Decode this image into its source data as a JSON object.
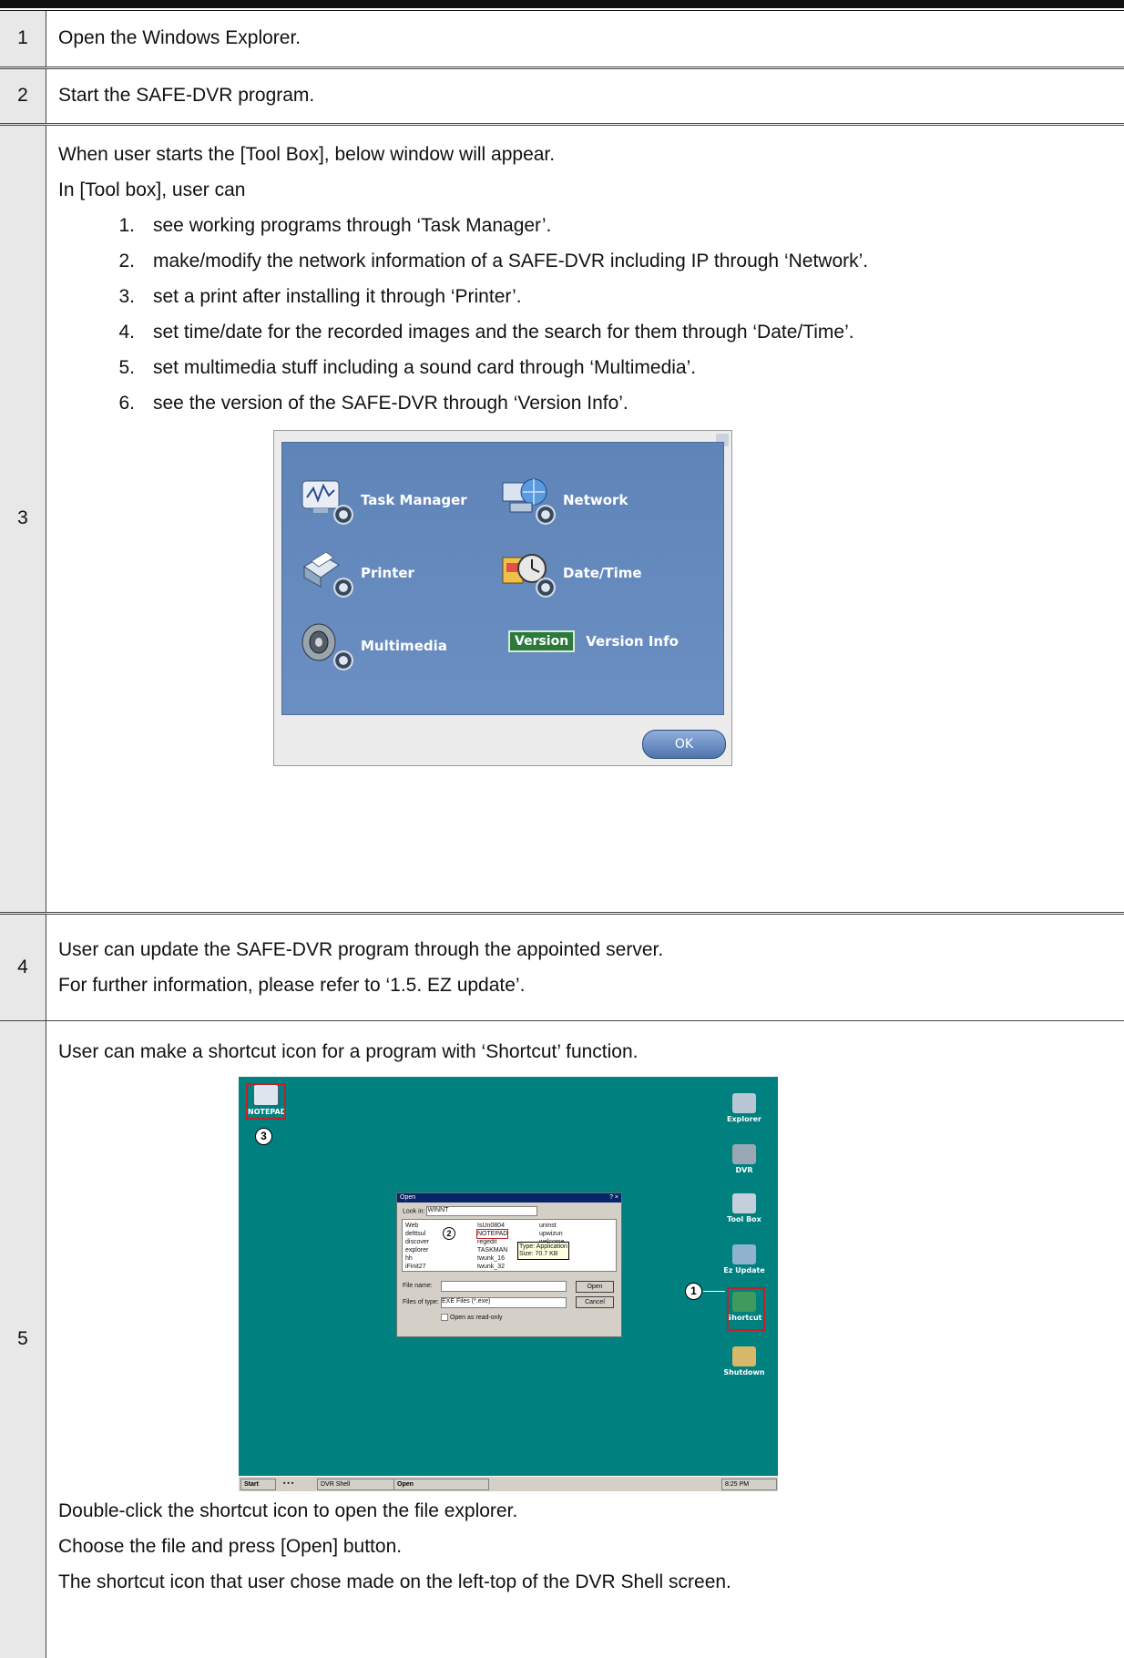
{
  "rows": [
    {
      "num": "1",
      "text": "Open the Windows Explorer."
    },
    {
      "num": "2",
      "text": "Start the SAFE-DVR program."
    },
    {
      "num": "3",
      "intro": "When user starts the [Tool Box], below window will appear.",
      "lead": "In [Tool box], user can",
      "items": [
        {
          "n": "1.",
          "text": "see working programs through ‘Task Manager’."
        },
        {
          "n": "2.",
          "text": "make/modify the network information of a SAFE-DVR including IP through ‘Network’."
        },
        {
          "n": "3.",
          "text": "set a print after installing it through ‘Printer’."
        },
        {
          "n": "4.",
          "text": "set time/date for the recorded images and the search for them through ‘Date/Time’."
        },
        {
          "n": "5.",
          "text": "set multimedia stuff including a sound card through ‘Multimedia’."
        },
        {
          "n": "6.",
          "text": "see the version of the SAFE-DVR through ‘Version Info’."
        }
      ],
      "toolbox": {
        "task_manager": "Task Manager",
        "network": "Network",
        "printer": "Printer",
        "date_time": "Date/Time",
        "multimedia": "Multimedia",
        "version_badge": "Version",
        "version_info": "Version Info",
        "ok": "OK"
      }
    },
    {
      "num": "4",
      "line1": "User can update the SAFE-DVR program through the appointed server.",
      "line2": "For further information, please refer to ‘1.5. EZ update’."
    },
    {
      "num": "5",
      "intro": "User can make a shortcut icon for a program with ‘Shortcut’ function.",
      "after": [
        "Double-click the shortcut icon to open the file explorer.",
        "Choose the file and press [Open] button.",
        "The shortcut icon that user chose made on the left-top of the DVR Shell screen."
      ],
      "desktop": {
        "notepad_icon": "NOTEPAD",
        "callout_1": "1",
        "callout_2": "2",
        "callout_3": "3",
        "side_icons": [
          "Explorer",
          "DVR",
          "Tool Box",
          "Ez Update",
          "Shortcut",
          "Shutdown"
        ],
        "dialog": {
          "title": "Open",
          "help_close": "? ×",
          "look_in_label": "Look in:",
          "look_in_value": "WINNT",
          "files_col1": [
            "Web",
            "delttsul",
            "discover",
            "explorer",
            "hh",
            "iFinit27"
          ],
          "files_col2": [
            "IsUn0804",
            "NOTEPAD",
            "regedit",
            "TASKMAN",
            "twunk_16",
            "twunk_32"
          ],
          "files_col3": [
            "uninst",
            "upwizun",
            "welcome"
          ],
          "tooltip_line1": "Type: Application",
          "tooltip_line2": "Size: 70.7 KB",
          "file_name_label": "File name:",
          "files_of_type_label": "Files of type:",
          "files_of_type_value": "EXE Files (*.exe)",
          "open_btn": "Open",
          "cancel_btn": "Cancel",
          "readonly": "Open as read-only"
        },
        "taskbar": {
          "start": "Start",
          "task1": "DVR Shell",
          "task2": "Open",
          "clock": "8:25 PM"
        }
      }
    }
  ]
}
